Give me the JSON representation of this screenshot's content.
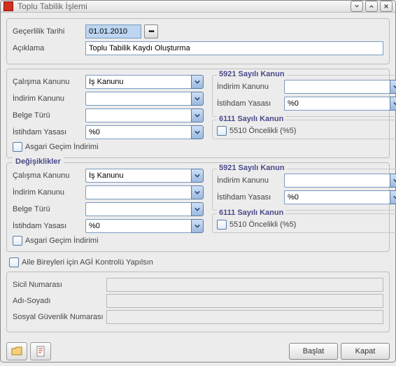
{
  "window": {
    "title": "Toplu Tabilik İşlemi"
  },
  "top": {
    "gecerlilik_label": "Geçerlilik Tarihi",
    "gecerlilik_value": "01.01.2010",
    "aciklama_label": "Açıklama",
    "aciklama_value": "Toplu Tabilik Kaydı Oluşturma"
  },
  "group1": {
    "left": {
      "calisma_label": "Çalışma Kanunu",
      "calisma_value": "İş Kanunu",
      "indirim_label": "İndirim Kanunu",
      "indirim_value": "",
      "belge_label": "Belge Türü",
      "belge_value": "",
      "istihdam_label": "İstihdam Yasası",
      "istihdam_value": "%0",
      "agi_label": "Asgari Geçim İndirimi"
    },
    "right": {
      "k5921_title": "5921 Sayılı Kanun",
      "indirim_label": "İndirim Kanunu",
      "indirim_value": "",
      "istihdam_label": "İstihdam Yasası",
      "istihdam_value": "%0",
      "k6111_title": "6111 Sayılı Kanun",
      "oncelikli_label": "5510 Öncelikli (%5)"
    }
  },
  "group2": {
    "title": "Değişiklikler",
    "left": {
      "calisma_label": "Çalışma Kanunu",
      "calisma_value": "İş Kanunu",
      "indirim_label": "İndirim Kanunu",
      "indirim_value": "",
      "belge_label": "Belge Türü",
      "belge_value": "",
      "istihdam_label": "İstihdam Yasası",
      "istihdam_value": "%0",
      "agi_label": "Asgari Geçim İndirimi"
    },
    "right": {
      "k5921_title": "5921 Sayılı Kanun",
      "indirim_label": "İndirim Kanunu",
      "indirim_value": "",
      "istihdam_label": "İstihdam Yasası",
      "istihdam_value": "%0",
      "k6111_title": "6111 Sayılı Kanun",
      "oncelikli_label": "5510 Öncelikli (%5)"
    }
  },
  "aile_label": "Aile Bireyleri için AGİ Kontrolü Yapılsın",
  "info": {
    "sicil_label": "Sicil Numarası",
    "sicil_value": "",
    "ad_label": "Adı-Soyadı",
    "ad_value": "",
    "sgk_label": "Sosyal Güvenlik Numarası",
    "sgk_value": ""
  },
  "footer": {
    "baslat": "Başlat",
    "kapat": "Kapat"
  }
}
